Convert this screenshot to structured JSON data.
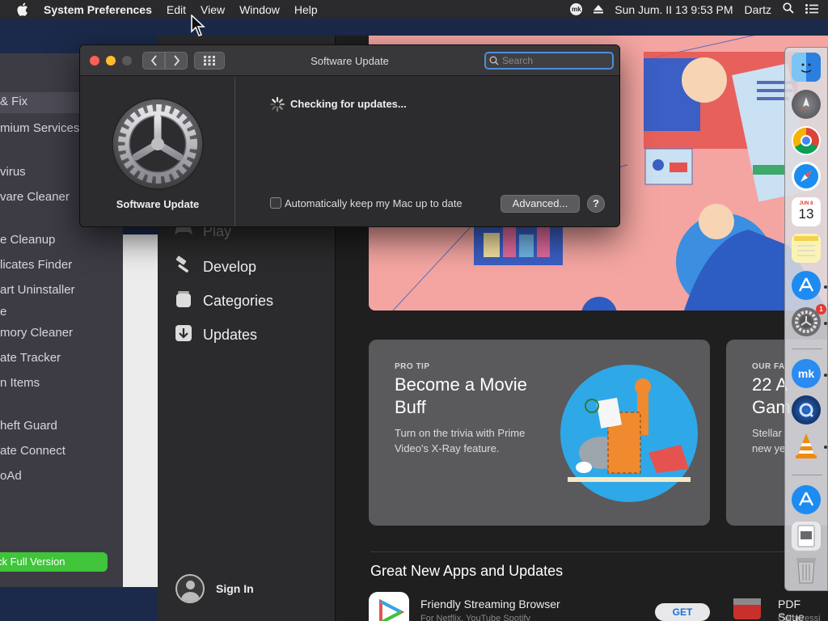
{
  "menubar": {
    "app_name": "System Preferences",
    "items": [
      "Edit",
      "View",
      "Window",
      "Help"
    ],
    "status_badge": "mk",
    "datetime": "Sun Jum. II 13  9:53 PM",
    "user": "Dartz"
  },
  "cleaner_sidebar": {
    "items": [
      "& Fix",
      "mium Services",
      "virus",
      "vare Cleaner",
      "e Cleanup",
      "licates Finder",
      "art Uninstaller",
      "e",
      "mory Cleaner",
      "ate Tracker",
      "n Items",
      "heft Guard",
      "ate Connect",
      "oAd"
    ],
    "unlock_button": "ck Full Version"
  },
  "appstore": {
    "nav": [
      {
        "label": "Play",
        "icon": "gamepad-icon"
      },
      {
        "label": "Develop",
        "icon": "hammer-icon"
      },
      {
        "label": "Categories",
        "icon": "categories-icon"
      },
      {
        "label": "Updates",
        "icon": "updates-icon"
      }
    ],
    "sign_in": "Sign In",
    "card1": {
      "eyebrow": "PRO TIP",
      "title": "Become a Movie Buff",
      "desc": "Turn on the trivia with Prime Video's X-Ray feature."
    },
    "card2": {
      "eyebrow": "OUR FA",
      "title": "22 A Gam",
      "desc": "Stellar new ye"
    },
    "section_title": "Great New Apps and Updates",
    "app1": {
      "title": "Friendly Streaming Browser",
      "subtitle": "For Netflix, YouTube Spotify",
      "get": "GET"
    },
    "app2": {
      "title": "PDF Sque",
      "subtitle": "Compressi"
    }
  },
  "dock": {
    "calendar_month": "JUN 8",
    "calendar_day": "13",
    "sysprefs_badge": "1",
    "mk_label": "mk",
    "items": [
      "finder-icon",
      "launchpad-icon",
      "chrome-icon",
      "safari-icon",
      "calendar-icon",
      "notes-icon",
      "app-store-icon",
      "system-preferences-icon",
      "mk-app-icon",
      "quicktime-icon",
      "vlc-icon",
      "app-store-icon",
      "preview-icon",
      "trash-icon"
    ]
  },
  "software_update": {
    "window_title": "Software Update",
    "search_placeholder": "Search",
    "pane_name": "Software Update",
    "status": "Checking for updates...",
    "auto_update_label": "Automatically keep my Mac up to date",
    "auto_update_checked": false,
    "advanced_button": "Advanced...",
    "help_button": "?"
  },
  "colors": {
    "menubar_bg": "#2a2a2c",
    "window_bg": "#2c2c2e",
    "accent": "#4a8fd9",
    "hero_bg": "#f4a5a1",
    "unlock_green": "#3fc43a"
  }
}
